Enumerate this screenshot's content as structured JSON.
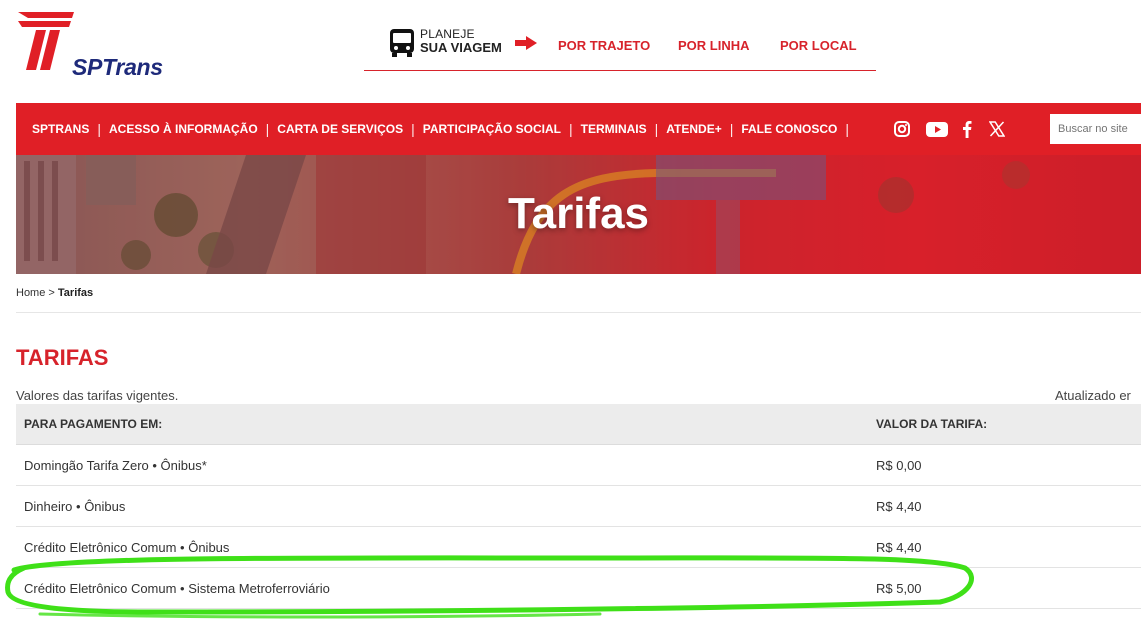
{
  "brand": {
    "name": "SPTrans"
  },
  "planner": {
    "line1": "PLANEJE",
    "line2": "SUA VIAGEM",
    "links": [
      "POR TRAJETO",
      "POR LINHA",
      "POR LOCAL"
    ]
  },
  "nav": {
    "items": [
      "SPTRANS",
      "ACESSO À INFORMAÇÃO",
      "CARTA DE SERVIÇOS",
      "PARTICIPAÇÃO SOCIAL",
      "TERMINAIS",
      "ATENDE+",
      "FALE CONOSCO"
    ],
    "social_icons": [
      "instagram-icon",
      "youtube-icon",
      "facebook-icon",
      "x-icon"
    ],
    "search_placeholder": "Buscar no site"
  },
  "banner": {
    "title": "Tarifas"
  },
  "breadcrumb": {
    "home": "Home",
    "separator": ">",
    "current": "Tarifas"
  },
  "page": {
    "heading": "TARIFAS",
    "subtitle": "Valores das tarifas vigentes.",
    "updated": "Atualizado er"
  },
  "table": {
    "headers": [
      "PARA PAGAMENTO EM:",
      "VALOR DA TARIFA:"
    ],
    "rows": [
      {
        "label": "Domingão Tarifa Zero • Ônibus*",
        "value": "R$ 0,00"
      },
      {
        "label": "Dinheiro • Ônibus",
        "value": "R$ 4,40"
      },
      {
        "label": "Crédito Eletrônico Comum • Ônibus",
        "value": "R$ 4,40"
      },
      {
        "label": "Crédito Eletrônico Comum • Sistema Metroferroviário",
        "value": "R$ 5,00"
      }
    ]
  },
  "colors": {
    "brand_red": "#e01f26",
    "brand_blue": "#1e2a7a",
    "highlight_green": "#3fe018"
  }
}
